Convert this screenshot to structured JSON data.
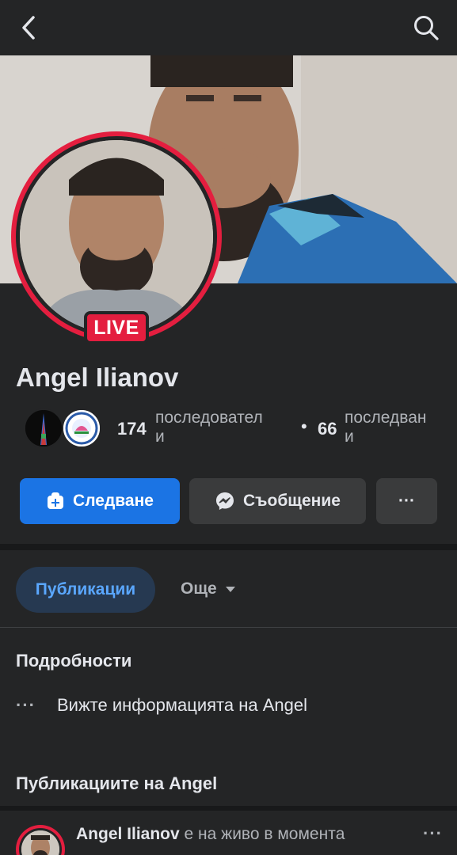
{
  "topbar": {
    "back_icon": "chevron-left-icon",
    "search_icon": "search-icon"
  },
  "profile": {
    "name": "Angel Ilianov",
    "live_label": "LIVE",
    "followers_count": "174",
    "followers_label_line1": "последовател",
    "followers_label_line2": "и",
    "following_count": "66",
    "following_label_line1": "последван",
    "following_label_line2": "и",
    "separator": "•"
  },
  "actions": {
    "follow_label": "Следване",
    "message_label": "Съобщение",
    "more_label": "···"
  },
  "tabs": {
    "active": "Публикации",
    "more": "Още"
  },
  "details": {
    "title": "Подробности",
    "info_text": "Вижте информацията на Angel",
    "info_icon": "···"
  },
  "posts": {
    "title": "Публикациите на Angel",
    "first_author": "Angel Ilianov",
    "first_status": "е на живо в моментa",
    "menu": "···"
  },
  "colors": {
    "background": "#242526",
    "accent_blue": "#1b74e4",
    "live_red": "#e41e3f",
    "tab_active_bg": "#263951",
    "tab_active_text": "#5aa7ff"
  }
}
